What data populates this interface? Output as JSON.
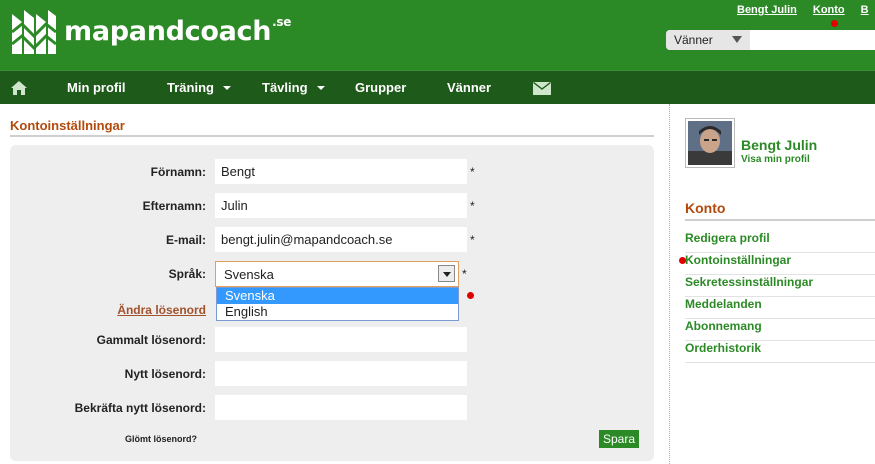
{
  "header": {
    "brand": "mapandcoach",
    "brand_suffix": ".se",
    "top_links": [
      "Bengt Julin",
      "Konto",
      "B"
    ],
    "filter_select": "Vänner"
  },
  "nav": {
    "items": [
      {
        "label": "Min profil"
      },
      {
        "label": "Träning"
      },
      {
        "label": "Tävling"
      },
      {
        "label": "Grupper"
      },
      {
        "label": "Vänner"
      }
    ]
  },
  "main": {
    "title": "Kontoinställningar",
    "fields": {
      "first_name": {
        "label": "Förnamn:",
        "value": "Bengt",
        "required": "*"
      },
      "last_name": {
        "label": "Efternamn:",
        "value": "Julin",
        "required": "*"
      },
      "email": {
        "label": "E-mail:",
        "value": "bengt.julin@mapandcoach.se",
        "required": "*"
      },
      "language": {
        "label": "Språk:",
        "value": "Svenska",
        "required": "*",
        "options": [
          "Svenska",
          "English"
        ]
      }
    },
    "change_password": "Ändra lösenord",
    "old_password_label": "Gammalt lösenord:",
    "new_password_label": "Nytt lösenord:",
    "confirm_password_label": "Bekräfta nytt lösenord:",
    "forgot_password": "Glömt lösenord?",
    "save": "Spara"
  },
  "sidebar": {
    "user_name": "Bengt Julin",
    "profile_link": "Visa min profil",
    "konto_title": "Konto",
    "menu": [
      "Redigera profil",
      "Kontoinställningar",
      "Sekretessinställningar",
      "Meddelanden",
      "Abonnemang",
      "Orderhistorik"
    ]
  },
  "colors": {
    "brand_green": "#2c8a26",
    "nav_green": "#1e5a1a",
    "heading_orange": "#b34a0b",
    "selected_blue": "#3399ff"
  }
}
